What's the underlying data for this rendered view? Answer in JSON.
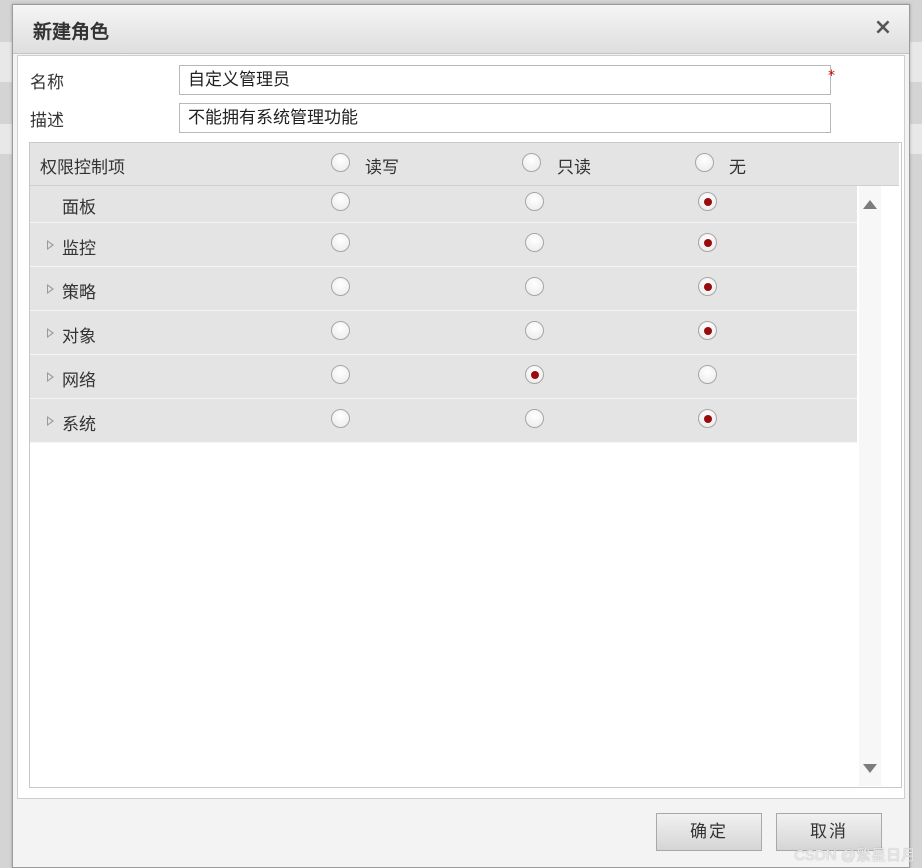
{
  "dialog": {
    "title": "新建角色",
    "close_glyph": "×"
  },
  "form": {
    "name_label": "名称",
    "name_value": "自定义管理员",
    "required_mark": "*",
    "desc_label": "描述",
    "desc_value": "不能拥有系统管理功能"
  },
  "grid": {
    "header_label": "权限控制项",
    "columns": [
      "读写",
      "只读",
      "无"
    ],
    "rows": [
      {
        "label": "面板",
        "expandable": false,
        "selected": "无"
      },
      {
        "label": "监控",
        "expandable": true,
        "selected": "无"
      },
      {
        "label": "策略",
        "expandable": true,
        "selected": "无"
      },
      {
        "label": "对象",
        "expandable": true,
        "selected": "无"
      },
      {
        "label": "网络",
        "expandable": true,
        "selected": "只读"
      },
      {
        "label": "系统",
        "expandable": true,
        "selected": "无"
      }
    ]
  },
  "buttons": {
    "ok": "确定",
    "cancel": "取消"
  },
  "watermark": "CSDN @繁星日月",
  "colors": {
    "accent_radio": "#9a0b0b",
    "required": "#d40000"
  }
}
